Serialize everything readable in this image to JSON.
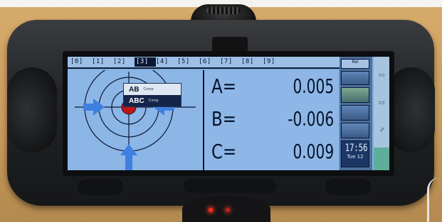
{
  "device": {
    "label_plate": "",
    "brand": "",
    "colors": {
      "screen": "#82aee0",
      "tab_active": "#0b1833",
      "text": "#07142c",
      "target_dot": "#c41414",
      "arrow": "#3f7fe0",
      "led": "#ff2a1a"
    }
  },
  "tabs": [
    {
      "label": "[0]"
    },
    {
      "label": "[1]"
    },
    {
      "label": "[2]"
    },
    {
      "label": "[3]"
    },
    {
      "label": "[4]"
    },
    {
      "label": "[5]"
    },
    {
      "label": "[6]"
    },
    {
      "label": "[7]"
    },
    {
      "label": "[8]"
    },
    {
      "label": "[9]"
    }
  ],
  "active_tab_index": 3,
  "dropdown": {
    "items": [
      {
        "key": "AB",
        "sub": "Comp",
        "selected": false
      },
      {
        "key": "ABC",
        "sub": "Comp",
        "selected": true
      }
    ]
  },
  "readings": [
    {
      "label": "A=",
      "value": "0.005"
    },
    {
      "label": "B=",
      "value": "-0.006"
    },
    {
      "label": "C=",
      "value": "0.009"
    }
  ],
  "side_buttons": {
    "top": "Rel",
    "clock_time": "17:56",
    "clock_date": "Tue 12"
  },
  "icons": {
    "target": "crosshair-target-icon",
    "arrows": "inward-arrow-icon"
  }
}
